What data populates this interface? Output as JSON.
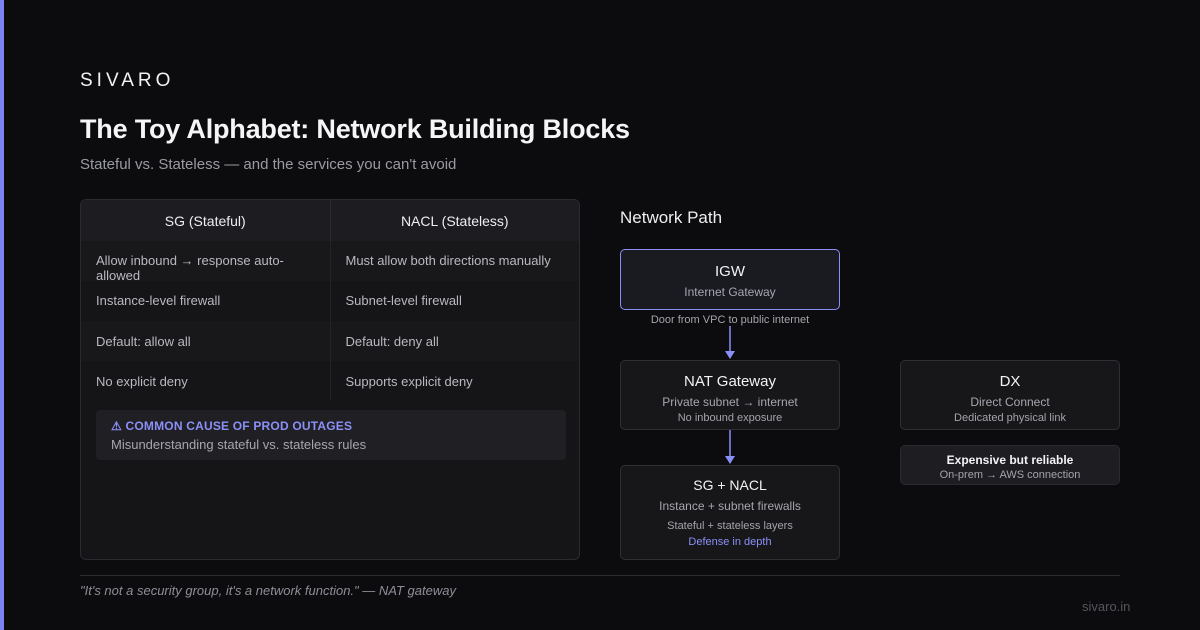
{
  "brand": "SIVARO",
  "title": "The Toy Alphabet: Network Building Blocks",
  "subtitle": "Stateful vs. Stateless — and the services you can't avoid",
  "table": {
    "headers": [
      "SG (Stateful)",
      "NACL (Stateless)"
    ],
    "rows": [
      [
        "Allow inbound → response auto-allowed",
        "Must allow both directions manually"
      ],
      [
        "Instance-level firewall",
        "Subnet-level firewall"
      ],
      [
        "Default: allow all",
        "Default: deny all"
      ],
      [
        "No explicit deny",
        "Supports explicit deny"
      ]
    ]
  },
  "warning": {
    "title": "⚠ COMMON CAUSE OF PROD OUTAGES",
    "body": "Misunderstanding stateful vs. stateless rules"
  },
  "network_path": {
    "title": "Network Path",
    "igw": {
      "name": "IGW",
      "sub": "Internet Gateway",
      "caption": "Door from VPC to public internet"
    },
    "nat": {
      "name": "NAT Gateway",
      "sub": "Private subnet → internet",
      "sub2": "No inbound exposure"
    },
    "sg": {
      "name": "SG + NACL",
      "sub": "Instance + subnet firewalls",
      "sub2": "Stateful + stateless layers",
      "accent": "Defense in depth"
    },
    "dx": {
      "name": "DX",
      "sub": "Direct Connect",
      "sub2": "Dedicated physical link"
    },
    "note": {
      "name": "Expensive but reliable",
      "sub2": "On-prem → AWS connection"
    }
  },
  "footer": {
    "quote": "\"It's not a security group, it's a network function.\" — NAT gateway",
    "domain": "sivaro.in"
  },
  "colors": {
    "accent": "#7c83f5",
    "background": "#0c0c0e"
  }
}
